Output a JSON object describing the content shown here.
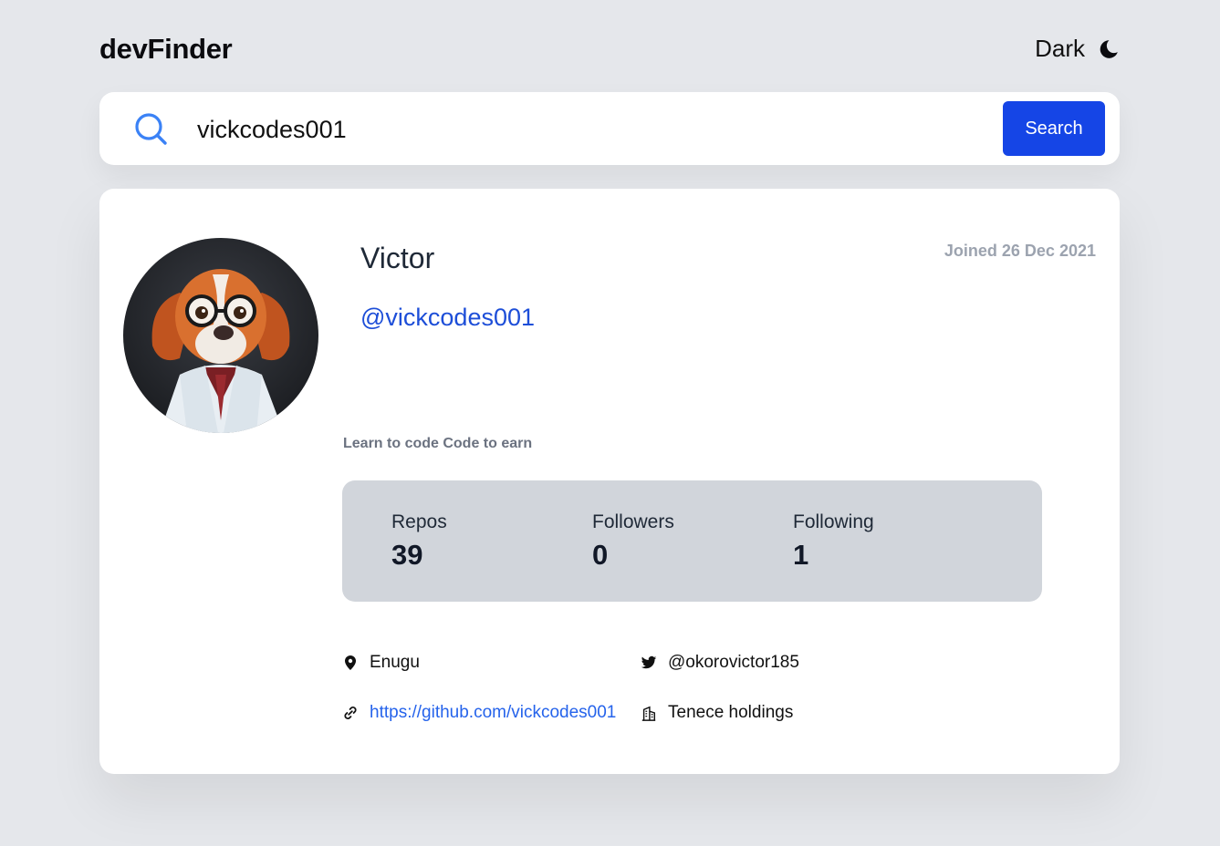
{
  "header": {
    "brand": "devFinder",
    "theme_label": "Dark",
    "theme_icon": "moon-icon"
  },
  "search": {
    "value": "vickcodes001",
    "placeholder": "",
    "button_label": "Search",
    "icon": "search-icon"
  },
  "profile": {
    "name": "Victor",
    "username": "@vickcodes001",
    "joined": "Joined 26 Dec 2021",
    "bio": "Learn to code Code to earn",
    "avatar_desc": "avatar"
  },
  "stats": [
    {
      "label": "Repos",
      "value": "39"
    },
    {
      "label": "Followers",
      "value": "0"
    },
    {
      "label": "Following",
      "value": "1"
    }
  ],
  "links": {
    "location": "Enugu",
    "twitter": "@okorovictor185",
    "website": "https://github.com/vickcodes001",
    "company": "Tenece holdings"
  },
  "colors": {
    "accent": "#1545e6",
    "background": "#e5e7eb",
    "card": "#ffffff",
    "stats_bg": "#d1d5db"
  }
}
